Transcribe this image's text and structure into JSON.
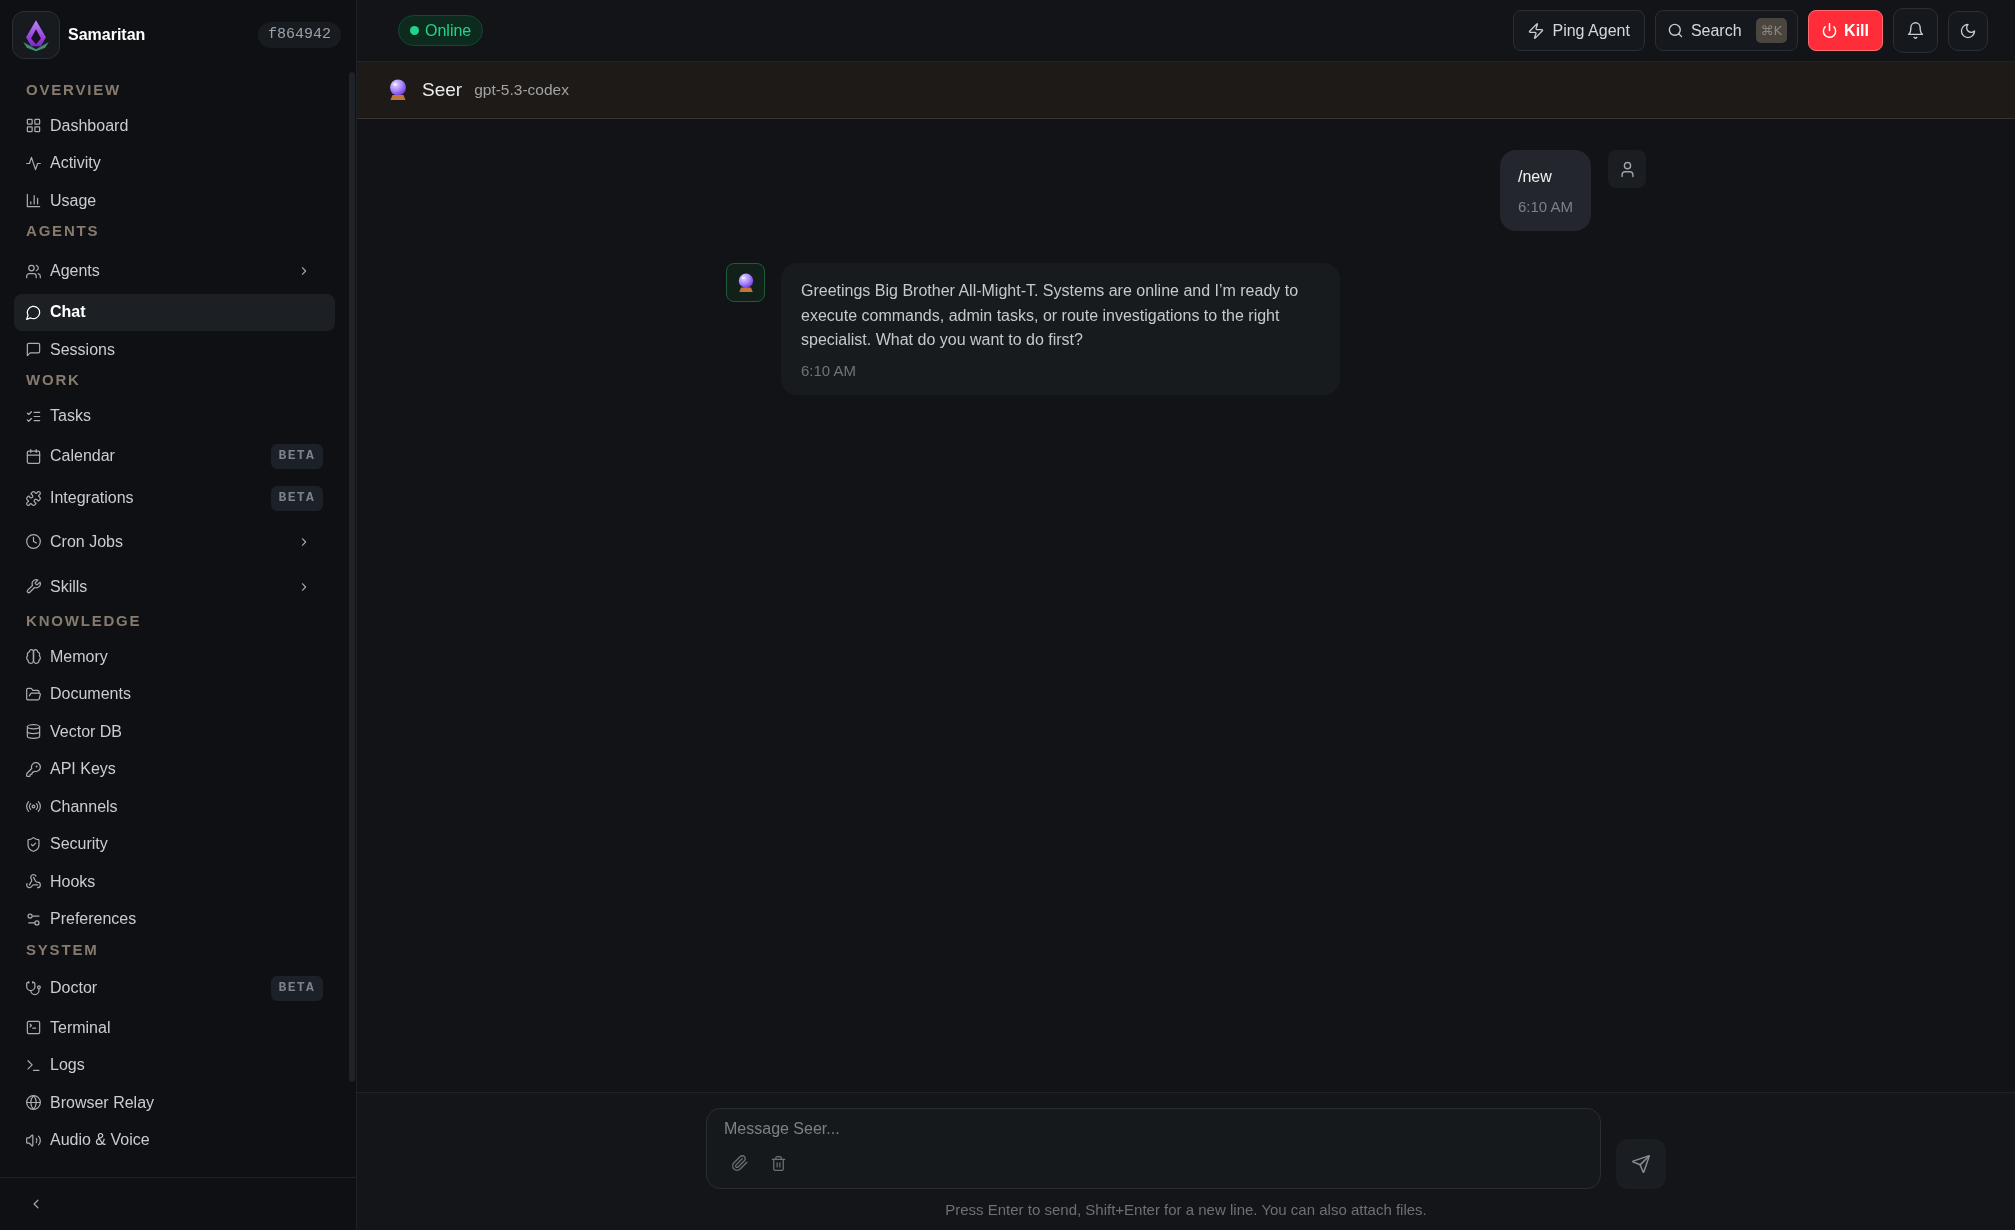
{
  "sidebar": {
    "brand": {
      "name": "Samaritan",
      "version": "f864942"
    },
    "sections": [
      {
        "heading": "OVERVIEW",
        "items": [
          {
            "label": "Dashboard",
            "kind": "link",
            "selected": false
          },
          {
            "label": "Activity",
            "kind": "link",
            "selected": false
          },
          {
            "label": "Usage",
            "kind": "link",
            "selected": false
          }
        ]
      },
      {
        "heading": "AGENTS",
        "items": [
          {
            "label": "Agents",
            "kind": "group",
            "selected": false
          },
          {
            "label": "Chat",
            "kind": "link",
            "selected": true
          },
          {
            "label": "Sessions",
            "kind": "link",
            "selected": false
          }
        ]
      },
      {
        "heading": "WORK",
        "items": [
          {
            "label": "Tasks",
            "kind": "link",
            "selected": false
          },
          {
            "label": "Calendar",
            "kind": "link",
            "selected": false,
            "badge": "BETA"
          },
          {
            "label": "Integrations",
            "kind": "link",
            "selected": false,
            "badge": "BETA"
          },
          {
            "label": "Cron Jobs",
            "kind": "group",
            "selected": false
          },
          {
            "label": "Skills",
            "kind": "group",
            "selected": false
          }
        ]
      },
      {
        "heading": "KNOWLEDGE",
        "items": [
          {
            "label": "Memory",
            "kind": "link",
            "selected": false
          },
          {
            "label": "Documents",
            "kind": "link",
            "selected": false
          },
          {
            "label": "Vector DB",
            "kind": "link",
            "selected": false
          },
          {
            "label": "API Keys",
            "kind": "link",
            "selected": false
          },
          {
            "label": "Channels",
            "kind": "link",
            "selected": false
          },
          {
            "label": "Security",
            "kind": "link",
            "selected": false
          },
          {
            "label": "Hooks",
            "kind": "link",
            "selected": false
          },
          {
            "label": "Preferences",
            "kind": "link",
            "selected": false
          }
        ]
      },
      {
        "heading": "SYSTEM",
        "items": [
          {
            "label": "Doctor",
            "kind": "link",
            "selected": false,
            "badge": "BETA"
          },
          {
            "label": "Terminal",
            "kind": "link",
            "selected": false
          },
          {
            "label": "Logs",
            "kind": "link",
            "selected": false
          },
          {
            "label": "Browser Relay",
            "kind": "link",
            "selected": false
          },
          {
            "label": "Audio & Voice",
            "kind": "link",
            "selected": false
          }
        ]
      }
    ]
  },
  "topbar": {
    "status": {
      "label": "Online",
      "online": true
    },
    "actions": [
      {
        "kind": "ping",
        "label": "Ping Agent"
      },
      {
        "kind": "search",
        "label": "Search",
        "shortcut": "⌘K"
      },
      {
        "kind": "kill",
        "label": "Kill"
      }
    ]
  },
  "agent": {
    "name": "Seer",
    "model": "gpt-5.3-codex"
  },
  "messages": [
    {
      "kind": "user",
      "text": "/new",
      "time": "6:10 AM"
    },
    {
      "kind": "assistant",
      "text": "Greetings Big Brother All-Might-T. Systems are online and I’m ready to execute commands, admin tasks, or route investigations to the right specialist. What do you want to do first?",
      "time": "6:10 AM"
    }
  ],
  "composer": {
    "placeholder": "Message Seer...",
    "hint": "Press Enter to send, Shift+Enter for a new line. You can also attach files."
  }
}
